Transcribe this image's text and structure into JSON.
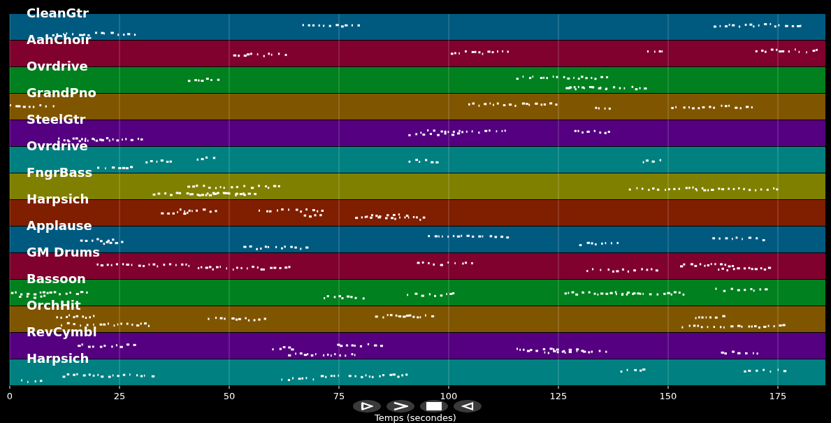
{
  "tracks": [
    {
      "name": "CleanGtr",
      "color": "#005a80"
    },
    {
      "name": "AahChoir",
      "color": "#80002e"
    },
    {
      "name": "Ovrdrive",
      "color": "#00801e"
    },
    {
      "name": "GrandPno",
      "color": "#805500"
    },
    {
      "name": "SteelGtr",
      "color": "#550080"
    },
    {
      "name": "Ovrdrive",
      "color": "#008080"
    },
    {
      "name": "FngrBass",
      "color": "#808000"
    },
    {
      "name": "Harpsich",
      "color": "#801e00"
    },
    {
      "name": "Applause",
      "color": "#005a80"
    },
    {
      "name": "GM Drums",
      "color": "#80002e"
    },
    {
      "name": "Bassoon",
      "color": "#00801e"
    },
    {
      "name": "OrchHit",
      "color": "#805500"
    },
    {
      "name": "RevCymbl",
      "color": "#550080"
    },
    {
      "name": "Harpsich",
      "color": "#008080"
    }
  ],
  "x_axis": {
    "ticks": [
      "0",
      "25",
      "50",
      "75",
      "100",
      "125",
      "150",
      "175"
    ],
    "label": "Temps (secondes)"
  },
  "controls": [
    {
      "kind": "play"
    },
    {
      "kind": "next"
    },
    {
      "kind": "stop"
    },
    {
      "kind": "back"
    }
  ]
}
